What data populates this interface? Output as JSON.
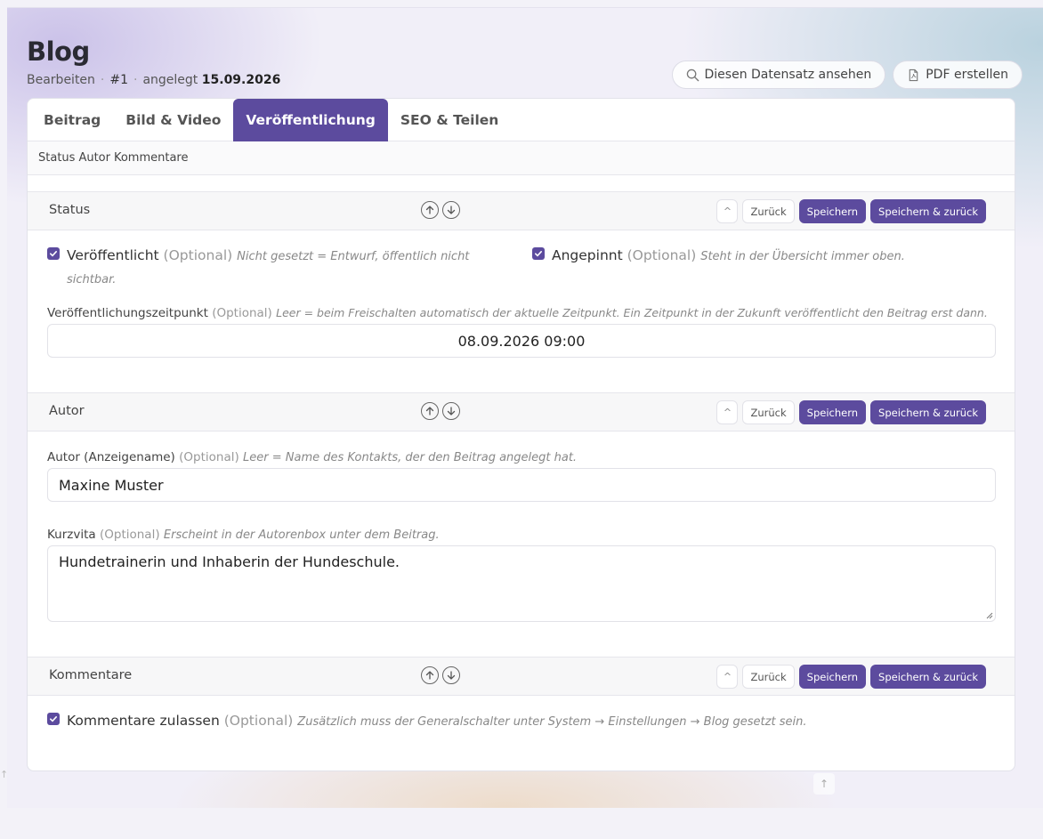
{
  "page": {
    "title": "Blog",
    "mode": "Bearbeiten",
    "record_id": "#1",
    "created_label": "angelegt",
    "created_date": "15.09.2026"
  },
  "top_actions": {
    "view_label": "Diesen Datensatz ansehen",
    "pdf_label": "PDF erstellen"
  },
  "tabs": [
    {
      "label": "Beitrag",
      "active": false
    },
    {
      "label": "Bild & Video",
      "active": false
    },
    {
      "label": "Veröffentlichung",
      "active": true
    },
    {
      "label": "SEO & Teilen",
      "active": false
    }
  ],
  "subnav": [
    "Status",
    "Autor",
    "Kommentare"
  ],
  "section_actions": {
    "caret": "^",
    "back": "Zurück",
    "save": "Speichern",
    "save_back": "Speichern & zurück"
  },
  "optional": "(Optional)",
  "sections": {
    "status": {
      "title": "Status",
      "published": {
        "label": "Veröffentlicht",
        "checked": true,
        "hint_line1": "Nicht gesetzt = Entwurf, öffentlich nicht",
        "hint_line2": "sichtbar."
      },
      "pinned": {
        "label": "Angepinnt",
        "checked": true,
        "hint": "Steht in der Übersicht immer oben."
      },
      "publish_time": {
        "label": "Veröffentlichungszeitpunkt",
        "hint": "Leer = beim Freischalten automatisch der aktuelle Zeitpunkt. Ein Zeitpunkt in der Zukunft veröffentlicht den Beitrag erst dann.",
        "value": "08.09.2026 09:00"
      }
    },
    "author": {
      "title": "Autor",
      "display_name": {
        "label": "Autor (Anzeigename)",
        "hint": "Leer = Name des Kontakts, der den Beitrag angelegt hat.",
        "value": "Maxine Muster"
      },
      "bio": {
        "label": "Kurzvita",
        "hint": "Erscheint in der Autorenbox unter dem Beitrag.",
        "value": "Hundetrainerin und Inhaberin der Hundeschule."
      }
    },
    "comments": {
      "title": "Kommentare",
      "allow": {
        "label": "Kommentare zulassen",
        "checked": true,
        "hint": "Zusätzlich muss der Generalschalter unter System → Einstellungen → Blog gesetzt sein."
      }
    }
  },
  "colors": {
    "accent": "#5c4b9e",
    "background": "#f1eff8"
  },
  "icons": {
    "view": "search-icon",
    "pdf": "pdf-file-icon",
    "move_up": "arrow-up-circle-icon",
    "move_down": "arrow-down-circle-icon",
    "checkbox": "check-icon"
  },
  "scroll_top": "↑"
}
